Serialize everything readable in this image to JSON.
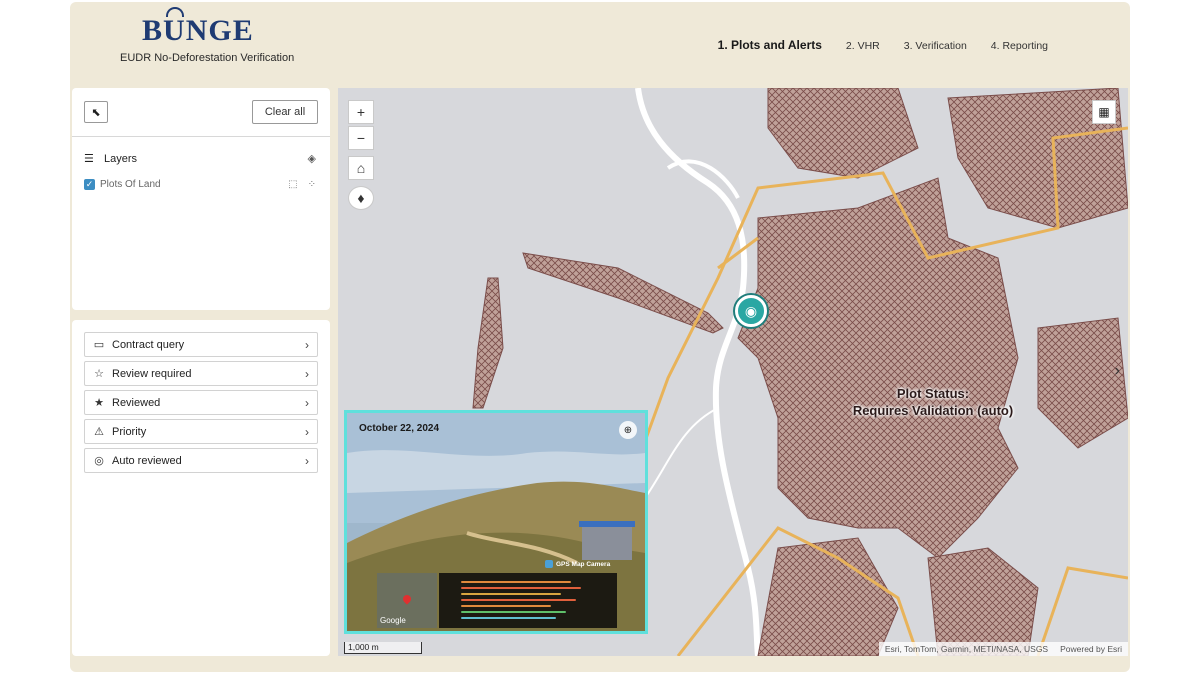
{
  "header": {
    "logo": {
      "pre": "B",
      "u": "U",
      "post": "NGE"
    },
    "subtitle": "EUDR No-Deforestation Verification",
    "nav": [
      {
        "label": "1. Plots and Alerts",
        "active": true
      },
      {
        "label": "2. VHR",
        "active": false
      },
      {
        "label": "3. Verification",
        "active": false
      },
      {
        "label": "4. Reporting",
        "active": false
      }
    ]
  },
  "sidebar": {
    "clear_label": "Clear all",
    "layers_title": "Layers",
    "layers": [
      {
        "label": "Plots Of Land",
        "checked": true
      }
    ],
    "filters": [
      {
        "label": "Contract query",
        "icon": "folder-icon"
      },
      {
        "label": "Review required",
        "icon": "star-outline-icon"
      },
      {
        "label": "Reviewed",
        "icon": "star-filled-icon"
      },
      {
        "label": "Priority",
        "icon": "hazard-icon"
      },
      {
        "label": "Auto reviewed",
        "icon": "auto-review-icon"
      }
    ]
  },
  "map": {
    "zoom_in": "+",
    "zoom_out": "−",
    "status_line1": "Plot Status:",
    "status_line2": "Requires Validation (auto)",
    "photo_date": "October 22, 2024",
    "gps_label": "GPS Map Camera",
    "mini_map_label": "Google",
    "attribution": "Esri, TomTom, Garmin, METI/NASA, USGS",
    "powered_by": "Powered by Esri",
    "scale_label": "1,000 m",
    "colors": {
      "plot_fill": "#b89a92",
      "plot_stroke": "#7a4d4a",
      "boundary": "#e8b35a",
      "water": "#ffffff",
      "highlight": "#5fe0dc"
    }
  }
}
